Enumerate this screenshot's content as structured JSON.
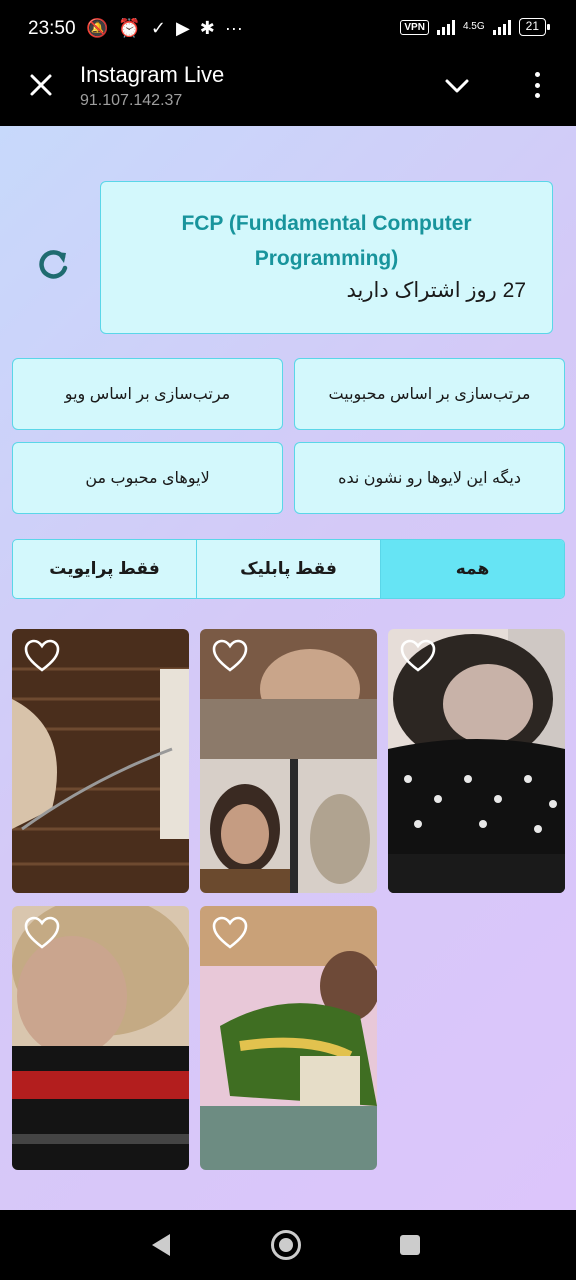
{
  "status_bar": {
    "time": "23:50",
    "vpn_label": "VPN",
    "network_label": "4.5G",
    "battery": "21"
  },
  "app_bar": {
    "title": "Instagram Live",
    "subtitle": "91.107.142.37"
  },
  "course": {
    "title": "FCP (Fundamental Computer Programming)",
    "subscription": "27 روز اشتراک دارید"
  },
  "actions": {
    "sort_by_popularity": "مرتب‌سازی بر اساس محبوبیت",
    "sort_by_views": "مرتب‌سازی بر اساس ویو",
    "hide_these_lives": "دیگه این لایوها رو نشون نده",
    "my_favorite_lives": "لایوهای محبوب من"
  },
  "filter_tabs": {
    "all": "همه",
    "public_only": "فقط پابلیک",
    "private_only": "فقط پرایویت",
    "selected": "all"
  },
  "live_thumbnails": [
    {
      "liked": false,
      "palette": [
        "#5e3a22",
        "#c9a98a",
        "#2b1a10"
      ]
    },
    {
      "liked": false,
      "palette": [
        "#8a6a55",
        "#d9c3b0",
        "#2a2a2a"
      ]
    },
    {
      "liked": false,
      "palette": [
        "#222222",
        "#f0e6e2",
        "#6b5a55"
      ]
    },
    {
      "liked": false,
      "palette": [
        "#c8b49a",
        "#1b1b1b",
        "#b02020"
      ]
    },
    {
      "liked": false,
      "palette": [
        "#e7c7d6",
        "#4c7a2a",
        "#d7b24a"
      ]
    }
  ],
  "colors": {
    "card_bg": "#d3f8fc",
    "card_border": "#5ad6e8",
    "accent_text": "#18949c",
    "active_tab": "#66e4f4"
  }
}
